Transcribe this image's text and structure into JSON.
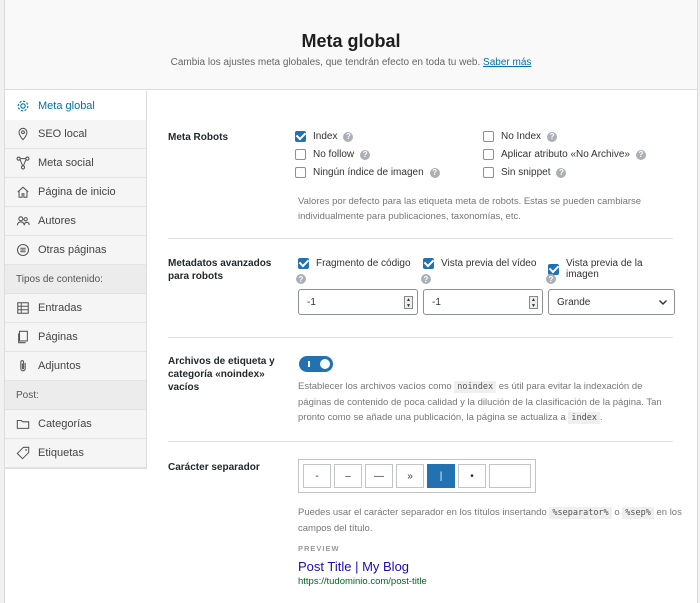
{
  "header": {
    "title": "Meta global",
    "subtitle": "Cambia los ajustes meta globales, que tendrán efecto en toda tu web.",
    "learn_more": "Saber más"
  },
  "sidebar": {
    "items": [
      {
        "label": "Meta global",
        "icon": "gear-icon"
      },
      {
        "label": "SEO local",
        "icon": "location-pin-icon"
      },
      {
        "label": "Meta social",
        "icon": "share-icon"
      },
      {
        "label": "Página de inicio",
        "icon": "home-icon"
      },
      {
        "label": "Autores",
        "icon": "users-icon"
      },
      {
        "label": "Otras páginas",
        "icon": "list-circle-icon"
      }
    ],
    "content_types_heading": "Tipos de contenido:",
    "content_types": [
      {
        "label": "Entradas",
        "icon": "grid-icon"
      },
      {
        "label": "Páginas",
        "icon": "pages-icon"
      },
      {
        "label": "Adjuntos",
        "icon": "paperclip-icon"
      }
    ],
    "post_heading": "Post:",
    "post_items": [
      {
        "label": "Categorías",
        "icon": "folder-icon"
      },
      {
        "label": "Etiquetas",
        "icon": "tag-icon"
      }
    ]
  },
  "meta_robots": {
    "label": "Meta Robots",
    "options": [
      {
        "label": "Index",
        "checked": true
      },
      {
        "label": "No Index",
        "checked": false
      },
      {
        "label": "No follow",
        "checked": false
      },
      {
        "label": "Aplicar atributo «No Archive»",
        "checked": false
      },
      {
        "label": "Ningún índice de imagen",
        "checked": false
      },
      {
        "label": "Sin snippet",
        "checked": false
      }
    ],
    "description": "Valores por defecto para las etiqueta meta de robots. Estas se pueden cambiarse individualmente para publicaciones, taxonomías, etc."
  },
  "advanced": {
    "label_line1": "Metadatos avanzados",
    "label_line2": "para robots",
    "options": [
      {
        "label": "Fragmento de código",
        "checked": true,
        "value": "-1"
      },
      {
        "label": "Vista previa del vídeo",
        "checked": true,
        "value": "-1"
      },
      {
        "label": "Vista previa de la imagen",
        "checked": true,
        "value": "Grande"
      }
    ]
  },
  "noindex": {
    "label_line1": "Archivos de etiqueta y",
    "label_line2": "categoría «noindex»",
    "label_line3": "vacíos",
    "enabled": true,
    "desc_part1": "Establecer los archivos vacíos como",
    "code1": "noindex",
    "desc_part2": "es útil para evitar la indexación de páginas de contenido de poca calidad y la dilución de la clasificación de la página. Tan pronto como se añade una publicación, la página se actualiza a",
    "code2": "index",
    "desc_part3": "."
  },
  "separator": {
    "label": "Carácter separador",
    "options": [
      "-",
      "–",
      "—",
      "»",
      "|",
      "•",
      ""
    ],
    "selected_index": 4,
    "desc_part1": "Puedes usar el carácter separador en los títulos insertando",
    "code1": "%separator%",
    "desc_or": "o",
    "code2": "%sep%",
    "desc_part2": "en los campos del título.",
    "preview_label": "PREVIEW",
    "preview_title": "Post Title | My Blog",
    "preview_url": "https://tudominio.com/post-title"
  },
  "colors": {
    "accent": "#2271b1",
    "link": "#0073aa"
  }
}
